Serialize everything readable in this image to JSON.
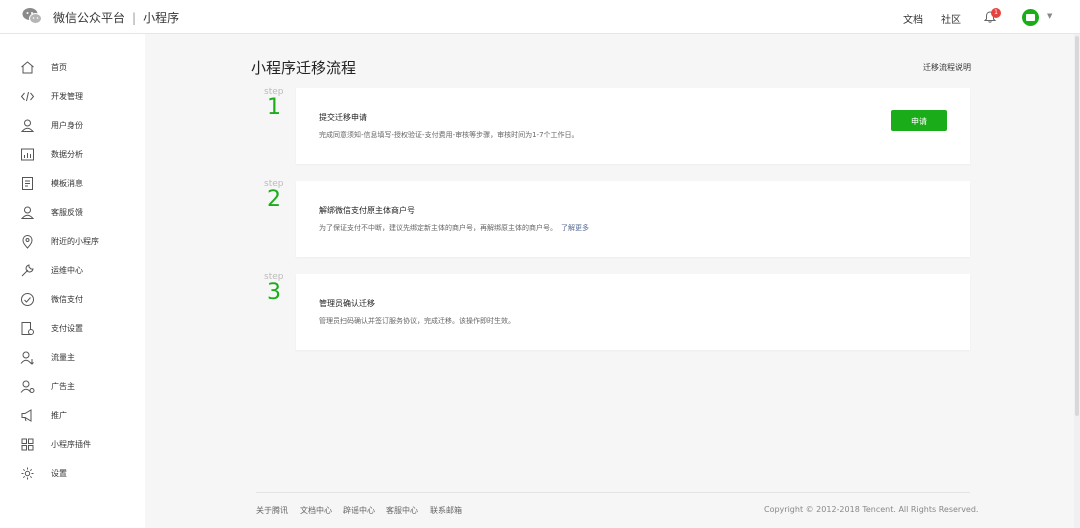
{
  "header": {
    "brand": "微信公众平台",
    "separator": "|",
    "product": "小程序",
    "nav": [
      "文档",
      "社区"
    ],
    "notification_count": "1"
  },
  "sidebar": {
    "items": [
      {
        "label": "首页",
        "icon": "home-icon"
      },
      {
        "label": "开发管理",
        "icon": "code-icon"
      },
      {
        "label": "用户身份",
        "icon": "user-icon"
      },
      {
        "label": "数据分析",
        "icon": "chart-icon"
      },
      {
        "label": "模板消息",
        "icon": "document-icon"
      },
      {
        "label": "客服反馈",
        "icon": "support-user-icon"
      },
      {
        "label": "附近的小程序",
        "icon": "location-icon"
      },
      {
        "label": "运维中心",
        "icon": "wrench-icon"
      },
      {
        "label": "微信支付",
        "icon": "wechat-pay-icon"
      },
      {
        "label": "支付设置",
        "icon": "payment-settings-icon"
      },
      {
        "label": "流量主",
        "icon": "traffic-owner-icon"
      },
      {
        "label": "广告主",
        "icon": "advertiser-icon"
      },
      {
        "label": "推广",
        "icon": "megaphone-icon"
      },
      {
        "label": "小程序插件",
        "icon": "plugin-grid-icon"
      },
      {
        "label": "设置",
        "icon": "gear-icon"
      }
    ]
  },
  "main": {
    "title": "小程序迁移流程",
    "help_link": "迁移流程说明",
    "step_word": "step",
    "steps": [
      {
        "number": "1",
        "title": "提交迁移申请",
        "desc": "完成同意须知-信息填写-授权验证-支付费用-审核等步骤，审核时间为1-7个工作日。",
        "button": "申请"
      },
      {
        "number": "2",
        "title": "解绑微信支付原主体商户号",
        "desc": "为了保证支付不中断，建议先绑定新主体的商户号，再解绑原主体的商户号。",
        "link": "了解更多"
      },
      {
        "number": "3",
        "title": "管理员确认迁移",
        "desc": "管理员扫码确认并签订服务协议，完成迁移。该操作即时生效。"
      }
    ]
  },
  "footer": {
    "links": [
      "关于腾讯",
      "文档中心",
      "辟谣中心",
      "客服中心",
      "联系邮箱"
    ],
    "copyright": "Copyright © 2012-2018 Tencent. All Rights Reserved."
  },
  "colors": {
    "accent": "#1aad19",
    "link": "#576b95",
    "badge": "#e64340"
  }
}
